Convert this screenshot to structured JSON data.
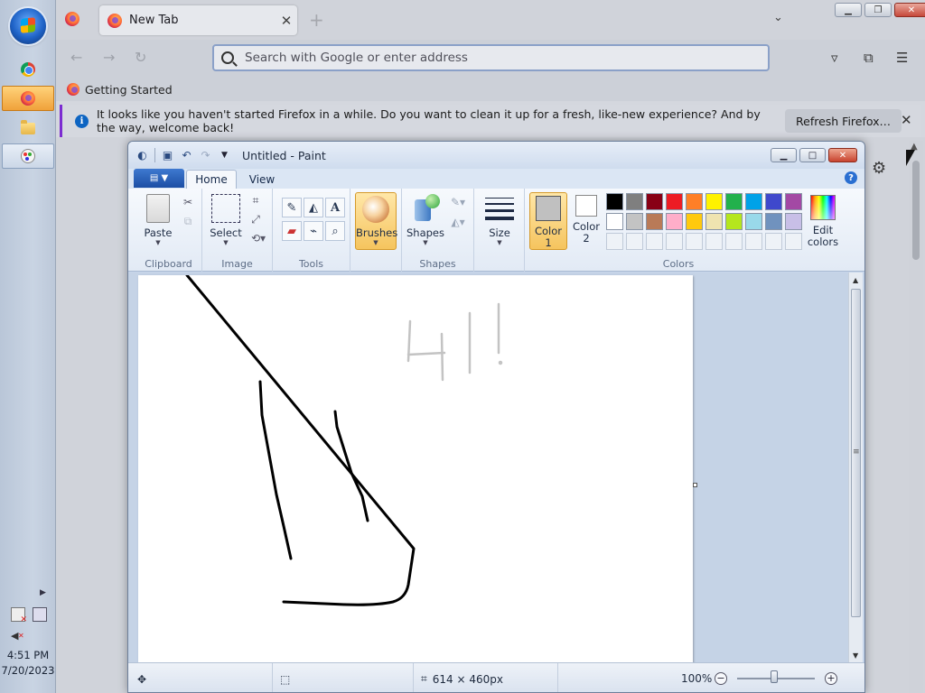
{
  "taskbar": {
    "start_icon": "windows-orb",
    "items": [
      {
        "name": "chrome",
        "icon": "chrome-icon"
      },
      {
        "name": "firefox",
        "icon": "firefox-icon",
        "state": "active"
      },
      {
        "name": "file-explorer",
        "icon": "folder-icon"
      },
      {
        "name": "paint",
        "icon": "paint-palette-icon",
        "state": "open"
      }
    ],
    "clock_time": "4:51 PM",
    "clock_date": "7/20/2023"
  },
  "firefox": {
    "tab_title": "New Tab",
    "url_placeholder": "Search with Google or enter address",
    "url_value": "",
    "bookmark_label": "Getting Started",
    "notification_text": "It looks like you haven't started Firefox in a while. Do you want to clean it up for a fresh, like-new experience? And by the way, welcome back!",
    "notification_button": "Refresh Firefox…",
    "colors": {
      "accent": "#7c2cd1",
      "info": "#0d64c2"
    }
  },
  "paint": {
    "window_title": "Untitled - Paint",
    "tabs": {
      "home": "Home",
      "view": "View"
    },
    "clipboard": {
      "paste": "Paste",
      "label": "Clipboard"
    },
    "image": {
      "select": "Select",
      "label": "Image"
    },
    "tools": {
      "label": "Tools"
    },
    "brushes": {
      "label": "Brushes"
    },
    "shapes": {
      "button": "Shapes",
      "label": "Shapes"
    },
    "size": {
      "label": "Size"
    },
    "colors": {
      "color1_label": "Color 1",
      "color2_label": "Color 2",
      "edit_label": "Edit colors",
      "group_label": "Colors",
      "color1": "#c0c0c0",
      "color2": "#ffffff",
      "palette_row1": [
        "#000000",
        "#7f7f7f",
        "#880015",
        "#ed1c24",
        "#ff7f27",
        "#fff200",
        "#22b14c",
        "#00a2e8",
        "#3f48cc",
        "#a349a4"
      ],
      "palette_row2": [
        "#ffffff",
        "#c3c3c3",
        "#b97a57",
        "#ffaec9",
        "#ffc90e",
        "#efe4b0",
        "#b5e61d",
        "#99d9ea",
        "#7092be",
        "#c8bfe7"
      ]
    },
    "status": {
      "canvas_size": "614 × 460px",
      "zoom": "100%"
    }
  }
}
